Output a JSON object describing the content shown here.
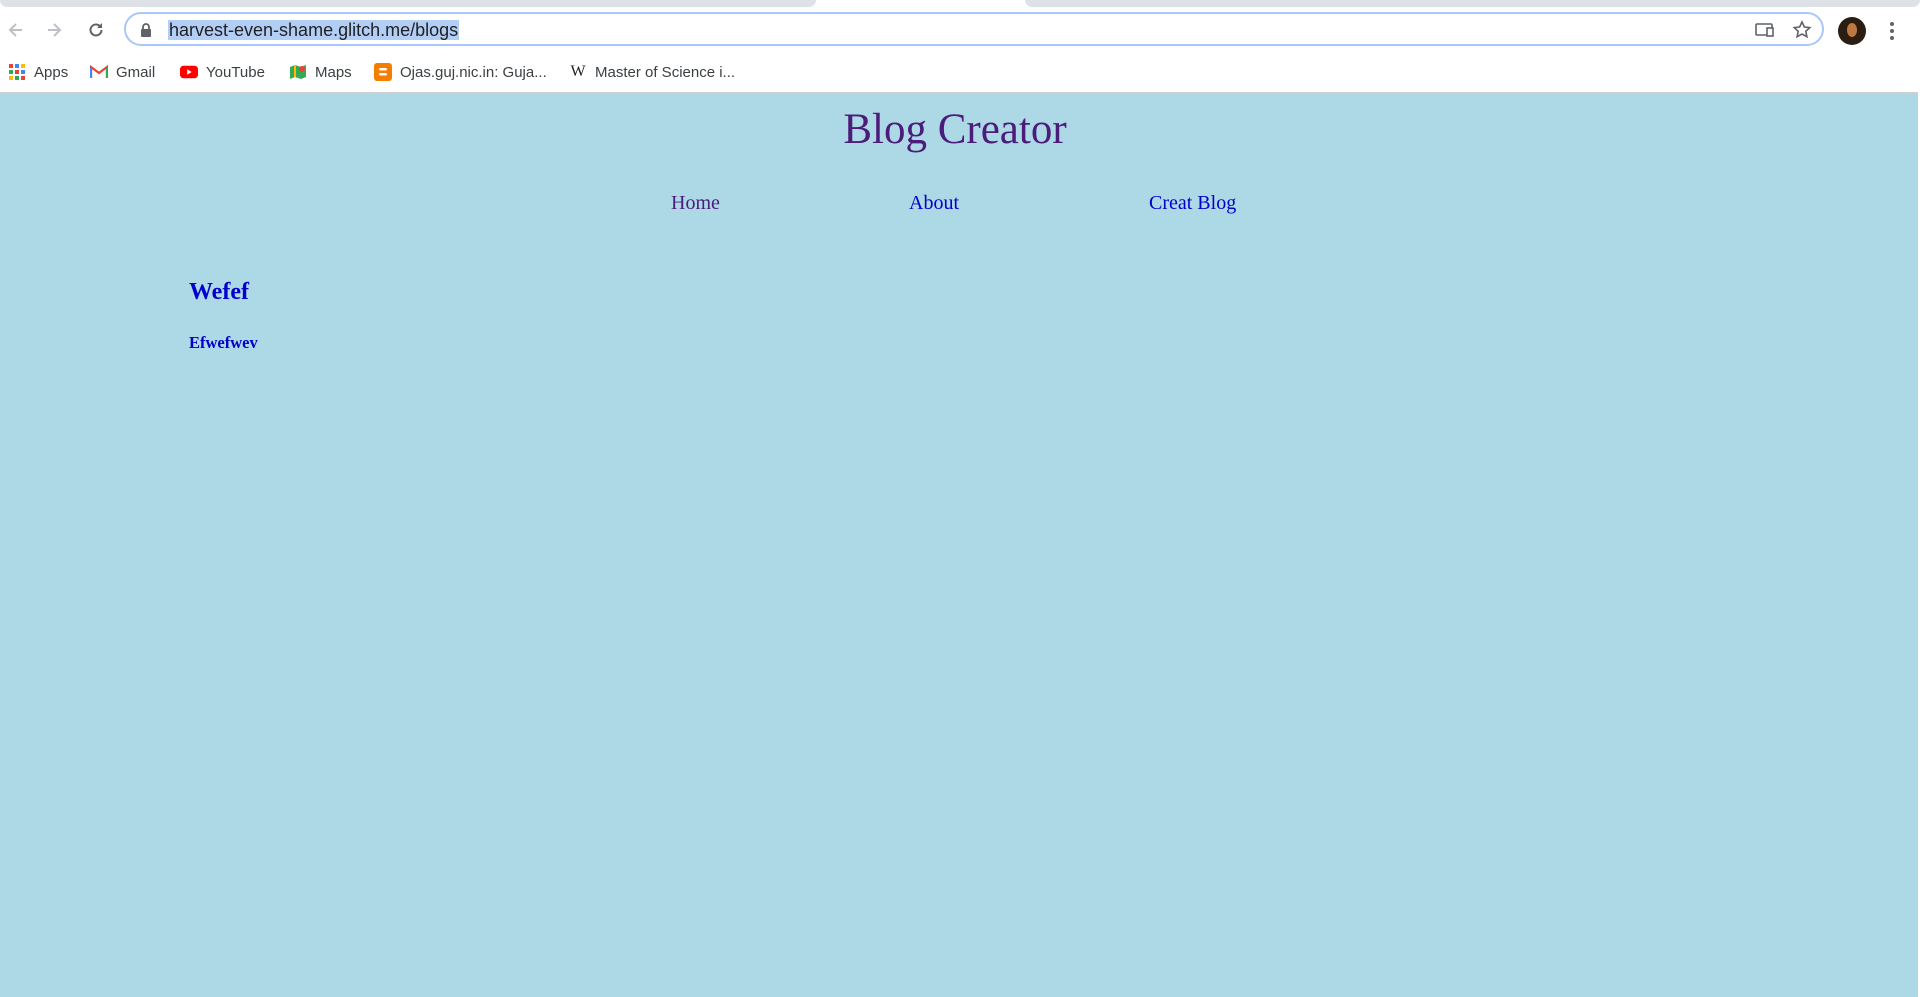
{
  "browser": {
    "url_text": "harvest-even-shame.glitch.me/blogs",
    "bookmarks": [
      {
        "label": "Apps",
        "icon": "apps-grid-icon"
      },
      {
        "label": "Gmail",
        "icon": "gmail-icon"
      },
      {
        "label": "YouTube",
        "icon": "youtube-icon"
      },
      {
        "label": "Maps",
        "icon": "maps-icon"
      },
      {
        "label": "Ojas.guj.nic.in: Guja...",
        "icon": "blogger-icon"
      },
      {
        "label": "Master of Science i...",
        "icon": "wikipedia-icon"
      }
    ]
  },
  "site": {
    "title": "Blog Creator",
    "nav": [
      {
        "label": "Home",
        "color": "#4b1c7a"
      },
      {
        "label": "About",
        "color": "#0000cd"
      },
      {
        "label": "Creat Blog",
        "color": "#0000cd"
      }
    ],
    "background": "#add8e6"
  },
  "post": {
    "title": "Wefef",
    "body": "Efwefwev"
  }
}
